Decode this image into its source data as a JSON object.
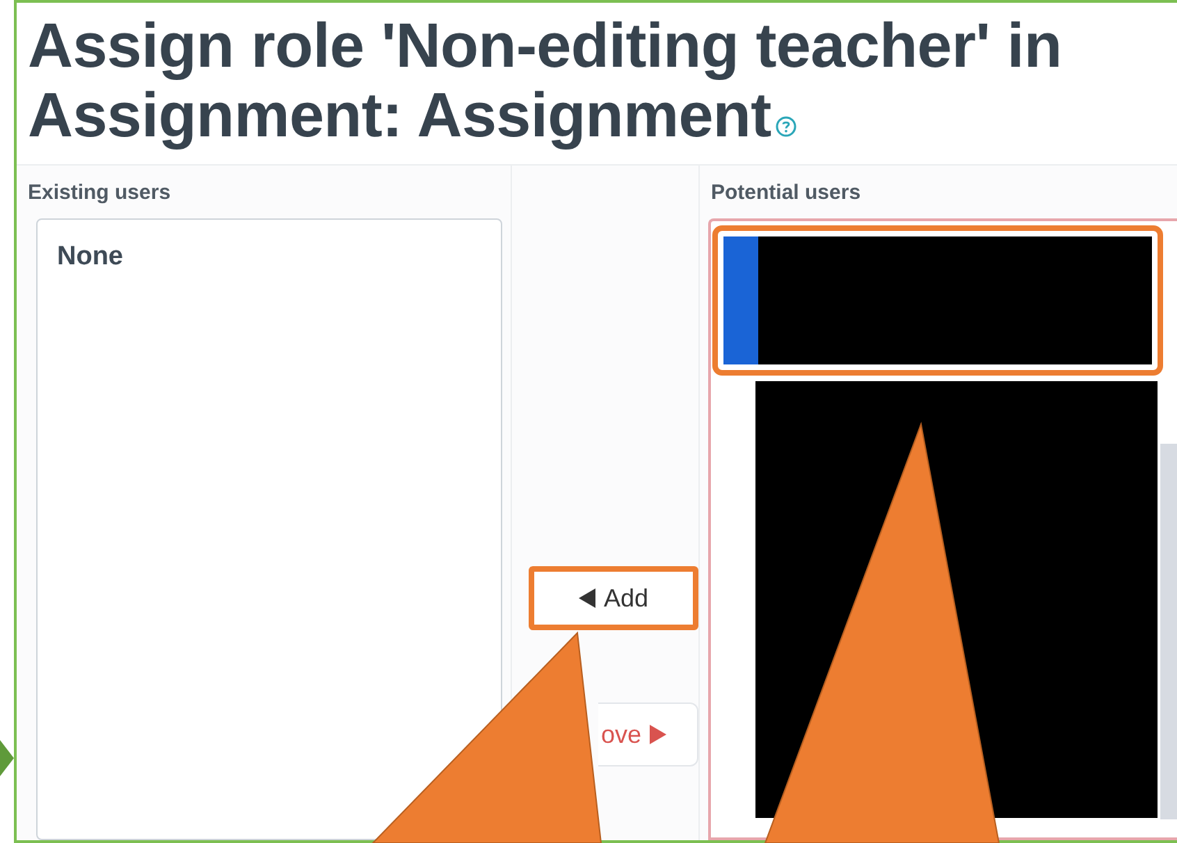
{
  "title": "Assign role 'Non-editing teacher' in Assignment: Assignment",
  "existing_users": {
    "label": "Existing users",
    "options": [
      {
        "text": "None",
        "selected": false
      }
    ]
  },
  "actions": [
    {
      "kind": "add",
      "label": "Add",
      "highlighted": true
    },
    {
      "kind": "remove",
      "label": "ove",
      "highlighted": false
    }
  ],
  "potential_users": {
    "label": "Potential users",
    "options": [
      {
        "kind": "redacted",
        "selected": true,
        "highlighted": true
      },
      {
        "kind": "redacted",
        "selected": false,
        "highlighted": false
      }
    ]
  }
}
